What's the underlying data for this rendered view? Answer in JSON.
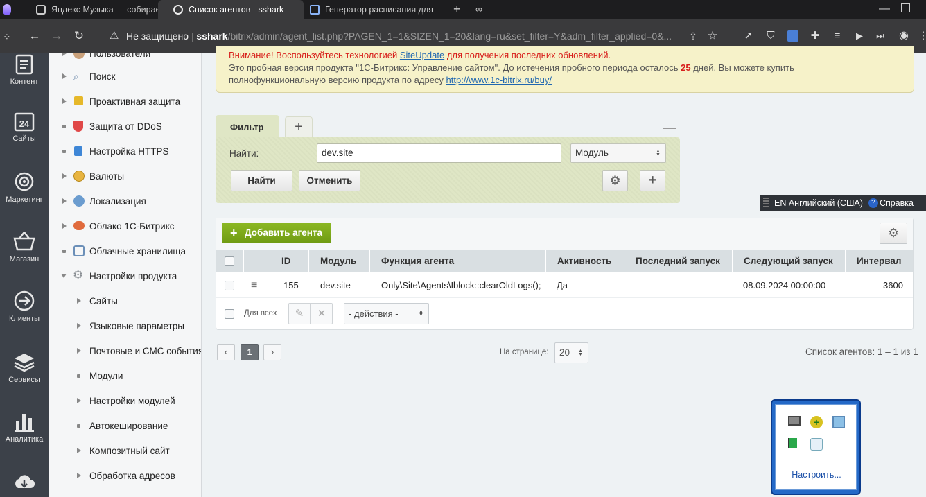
{
  "browser": {
    "tabs": [
      {
        "title": "Яндекс Музыка — собираем"
      },
      {
        "title": "Список агентов - sshark"
      },
      {
        "title": "Генератор расписания для"
      }
    ],
    "url_warning": "Не защищено",
    "url_host": "sshark",
    "url_path": "/bitrix/admin/agent_list.php?PAGEN_1=1&SIZEN_1=20&lang=ru&set_filter=Y&adm_filter_applied=0&..."
  },
  "leftpanel": {
    "items": [
      {
        "label": "Контент",
        "icon": "document-icon"
      },
      {
        "label": "Сайты",
        "icon": "calendar-24-icon"
      },
      {
        "label": "Маркетинг",
        "icon": "target-icon"
      },
      {
        "label": "Магазин",
        "icon": "basket-icon"
      },
      {
        "label": "Клиенты",
        "icon": "arrow-circle-icon"
      },
      {
        "label": "Сервисы",
        "icon": "layers-icon"
      },
      {
        "label": "Аналитика",
        "icon": "bar-chart-icon"
      }
    ]
  },
  "menu": {
    "items": [
      {
        "label": "Пользователи"
      },
      {
        "label": "Поиск"
      },
      {
        "label": "Проактивная защита"
      },
      {
        "label": "Защита от DDoS"
      },
      {
        "label": "Настройка HTTPS"
      },
      {
        "label": "Валюты"
      },
      {
        "label": "Локализация"
      },
      {
        "label": "Облако 1С-Битрикс"
      },
      {
        "label": "Облачные хранилища"
      },
      {
        "label": "Настройки продукта"
      },
      {
        "label": "Сайты"
      },
      {
        "label": "Языковые параметры"
      },
      {
        "label": "Почтовые и СМС события"
      },
      {
        "label": "Модули"
      },
      {
        "label": "Настройки модулей"
      },
      {
        "label": "Автокеширование"
      },
      {
        "label": "Композитный сайт"
      },
      {
        "label": "Обработка адресов"
      }
    ]
  },
  "notice": {
    "warn_prefix": "Внимание! Воспользуйтесь технологией ",
    "warn_link": "SiteUpdate",
    "warn_suffix": " для получения последних обновлений.",
    "line2_prefix": "Это пробная версия продукта \"1С-Битрикс: Управление сайтом\". До истечения пробного периода осталось ",
    "days": "25",
    "line2_suffix": " дней. Вы можете купить",
    "line3_prefix": "полнофункциональную версию продукта по адресу ",
    "link": "http://www.1c-bitrix.ru/buy/"
  },
  "filter": {
    "tab_label": "Фильтр",
    "add_tab": "+",
    "minimize": "—",
    "find_label": "Найти:",
    "find_value": "dev.site",
    "module_select": "Модуль",
    "find_button": "Найти",
    "cancel_button": "Отменить"
  },
  "langbar": {
    "language": "EN Английский (США)",
    "help": "Справка"
  },
  "grid": {
    "add_button": "Добавить агента",
    "columns": [
      "ID",
      "Модуль",
      "Функция агента",
      "Активность",
      "Последний запуск",
      "Следующий запуск",
      "Интервал"
    ],
    "rows": [
      {
        "id": "155",
        "module": "dev.site",
        "function": "Only\\Site\\Agents\\Iblock::clearOldLogs();",
        "active": "Да",
        "last_run": "",
        "next_run": "08.09.2024 00:00:00",
        "interval": "3600"
      }
    ],
    "for_all": "Для всех",
    "actions_select": "- действия -"
  },
  "pagination": {
    "current_page": "1",
    "per_page_label": "На странице:",
    "per_page_value": "20",
    "summary": "Список агентов: 1 – 1 из 1"
  },
  "tray": {
    "configure": "Настроить..."
  }
}
